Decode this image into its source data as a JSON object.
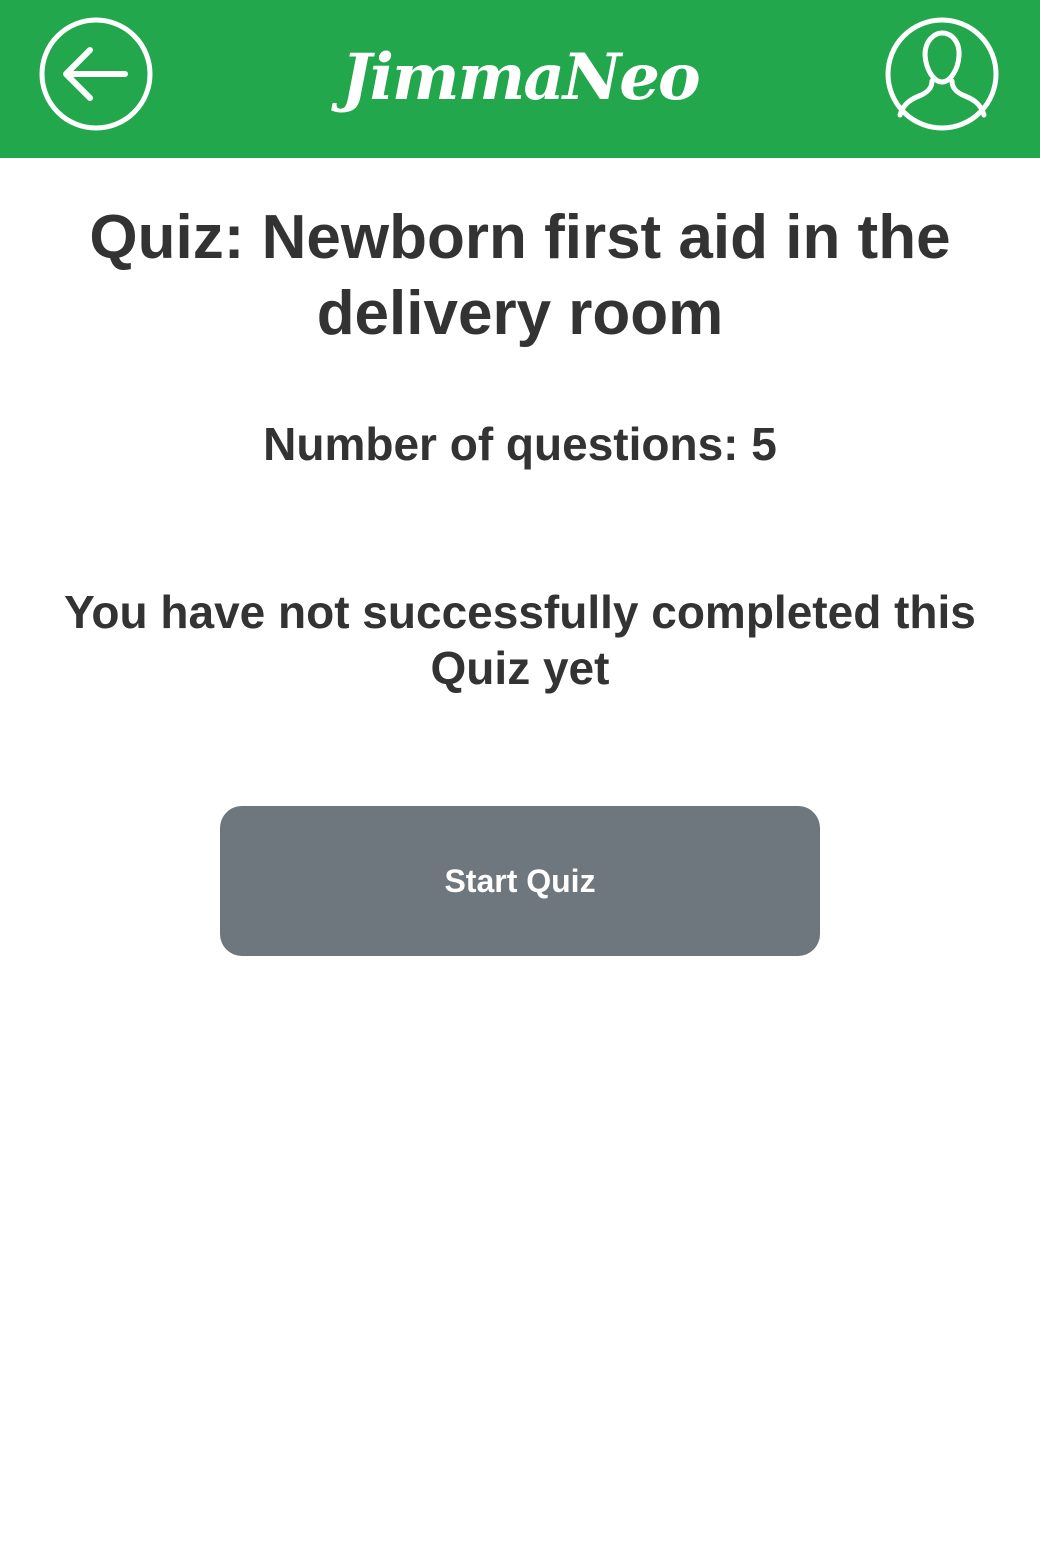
{
  "header": {
    "back_icon": "arrow-left-circle-icon",
    "logo_text": "JimmaNeo",
    "profile_icon": "user-circle-icon",
    "background_color": "#22a74d"
  },
  "quiz": {
    "title": "Quiz: Newborn first aid in the delivery room",
    "question_count_text": "Number of questions: 5",
    "status_text": "You have not successfully completed this Quiz yet",
    "start_button_label": "Start Quiz",
    "start_button_color": "#6e767e"
  }
}
